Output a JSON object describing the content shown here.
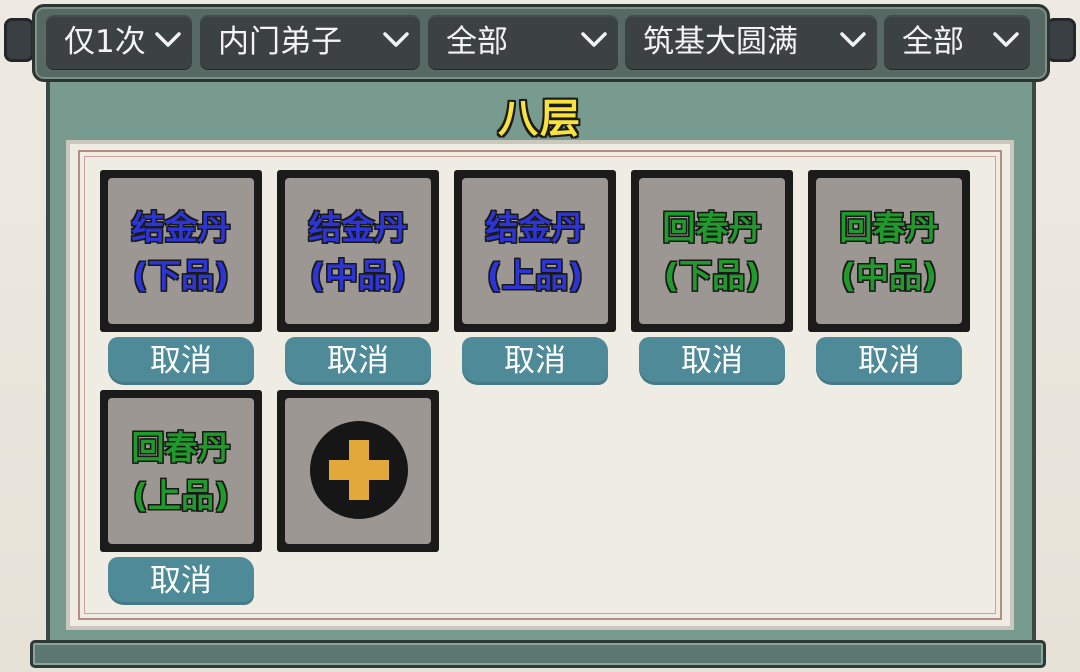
{
  "filters": [
    {
      "label": "仅1次"
    },
    {
      "label": "内门弟子"
    },
    {
      "label": "全部"
    },
    {
      "label": "筑基大圆满"
    },
    {
      "label": "全部"
    }
  ],
  "floor": {
    "title": "八层"
  },
  "slots": [
    {
      "name": "结金丹\n(下品)",
      "color": "blue",
      "action": "取消"
    },
    {
      "name": "结金丹\n(中品)",
      "color": "blue",
      "action": "取消"
    },
    {
      "name": "结金丹\n(上品)",
      "color": "blue",
      "action": "取消"
    },
    {
      "name": "回春丹\n(下品)",
      "color": "green",
      "action": "取消"
    },
    {
      "name": "回春丹\n(中品)",
      "color": "green",
      "action": "取消"
    },
    {
      "name": "回春丹\n(上品)",
      "color": "green",
      "action": "取消"
    }
  ],
  "add_slot": {
    "icon": "plus-icon"
  },
  "colors": {
    "blue_text": "#2d35d6",
    "green_text": "#219a2c",
    "title_yellow": "#f8e33c",
    "button_teal": "#4f8a98",
    "panel_green": "#789b90"
  }
}
